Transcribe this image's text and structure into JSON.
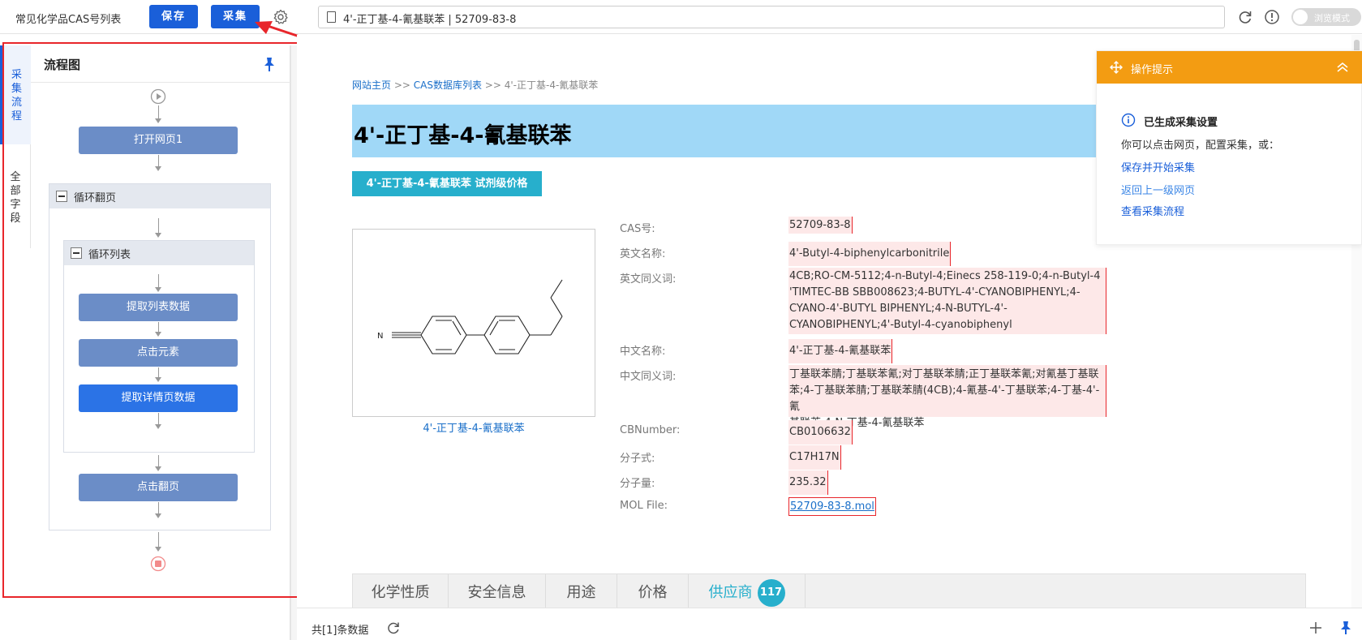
{
  "toolbar": {
    "task_title": "常见化学品CAS号列表",
    "save_label": "保存",
    "collect_label": "采集",
    "url": "4'-正丁基-4-氰基联苯 | 52709-83-8",
    "toggle_label": "浏览模式"
  },
  "side_tabs": {
    "tab1": "采集流程",
    "tab2": "全部字段"
  },
  "flow": {
    "title": "流程图",
    "open_page": "打开网页1",
    "loop_paging": "循环翻页",
    "loop_list": "循环列表",
    "extract_list": "提取列表数据",
    "click_element": "点击元素",
    "extract_detail": "提取详情页数据",
    "click_next": "点击翻页"
  },
  "page": {
    "breadcrumb": {
      "home": "网站主页",
      "sep1": " >> ",
      "list": "CAS数据库列表",
      "sep2": " >> ",
      "current": "4'-正丁基-4-氰基联苯"
    },
    "title": "4'-正丁基-4-氰基联苯",
    "price_button": "4'-正丁基-4-氰基联苯 试剂级价格",
    "structure_caption": "4'-正丁基-4-氰基联苯",
    "properties": [
      {
        "label": "CAS号:",
        "value": "52709-83-8"
      },
      {
        "label": "英文名称:",
        "value": "4'-Butyl-4-biphenylcarbonitrile"
      },
      {
        "label": "英文同义词:",
        "value_lines": [
          "4CB;RO-CM-5112;4-n-Butyl-4;Einecs 258-119-0;4-n-Butyl-4",
          "'TIMTEC-BB SBB008623;4-BUTYL-4'-CYANOBIPHENYL;4-",
          "CYANO-4'-BUTYL BIPHENYL;4-N-BUTYL-4'-",
          "CYANOBIPHENYL;4'-Butyl-4-cyanobiphenyl"
        ]
      },
      {
        "label": "中文名称:",
        "value": "4'-正丁基-4-氰基联苯"
      },
      {
        "label": "中文同义词:",
        "value_lines": [
          "丁基联苯腈;丁基联苯氰;对丁基联苯腈;正丁基联苯氰;对氰基丁基联",
          "苯;4-丁基联苯腈;丁基联苯腈(4CB);4-氰基-4'-丁基联苯;4-丁基-4'-氰",
          "基联苯;4-N-丁基-4-氰基联苯"
        ]
      },
      {
        "label": "CBNumber:",
        "value": "CB0106632"
      },
      {
        "label": "分子式:",
        "value": "C17H17N"
      },
      {
        "label": "分子量:",
        "value": "235.32"
      },
      {
        "label": "MOL File:",
        "value": "52709-83-8.mol"
      }
    ],
    "tabs": [
      "化学性质",
      "安全信息",
      "用途",
      "价格",
      "供应商"
    ],
    "supplier_count": "117",
    "structure_atom": "N"
  },
  "tips": {
    "title": "操作提示",
    "heading": "已生成采集设置",
    "desc": "你可以点击网页，配置采集，或：",
    "link1": "保存并开始采集",
    "link2": "返回上一级网页",
    "link3": "查看采集流程"
  },
  "bottom": {
    "record_count": "共[1]条数据"
  },
  "colors": {
    "primary": "#1a5fd9",
    "flow_node": "#6b8dc7",
    "tips_header": "#f39c12",
    "title_band": "#a0d8f7",
    "accent_teal": "#27afcc",
    "annotation_red": "#e8262b"
  }
}
